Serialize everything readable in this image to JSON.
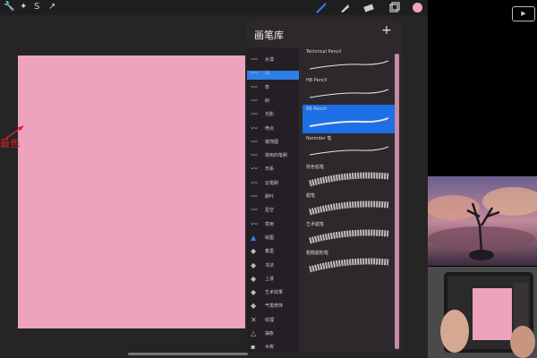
{
  "panel": {
    "title": "画笔库",
    "add_label": "+"
  },
  "categories": [
    {
      "label": "水漠"
    },
    {
      "label": "山"
    },
    {
      "label": "草"
    },
    {
      "label": "树"
    },
    {
      "label": "光影"
    },
    {
      "label": "喷点"
    },
    {
      "label": "装饰图"
    },
    {
      "label": "常用的笔刷"
    },
    {
      "label": "日系"
    },
    {
      "label": "云笔刷"
    },
    {
      "label": "刷叶"
    },
    {
      "label": "星空"
    },
    {
      "label": "草用"
    },
    {
      "label": "绘图"
    },
    {
      "label": "着墨"
    },
    {
      "label": "书法"
    },
    {
      "label": "上漆"
    },
    {
      "label": "艺术效果"
    },
    {
      "label": "气笔修饰"
    },
    {
      "label": "纹理"
    },
    {
      "label": "抽象"
    },
    {
      "label": "木炭"
    }
  ],
  "brushes": [
    {
      "name": "Technical Pencil"
    },
    {
      "name": "HB Pencil"
    },
    {
      "name": "6B Pencil",
      "selected": true
    },
    {
      "name": "Narinder 笔"
    },
    {
      "name": "软色铅笔"
    },
    {
      "name": "蜡笔"
    },
    {
      "name": "艺术蜡笔"
    },
    {
      "name": "粗糙蜡粉笔"
    }
  ],
  "annotation": {
    "text": "最色"
  },
  "colors": {
    "canvas_pink": "#eda3bd",
    "accent_blue": "#2f7fe6",
    "panel_bg": "#2c282c"
  },
  "camera": {
    "label": "▶"
  }
}
